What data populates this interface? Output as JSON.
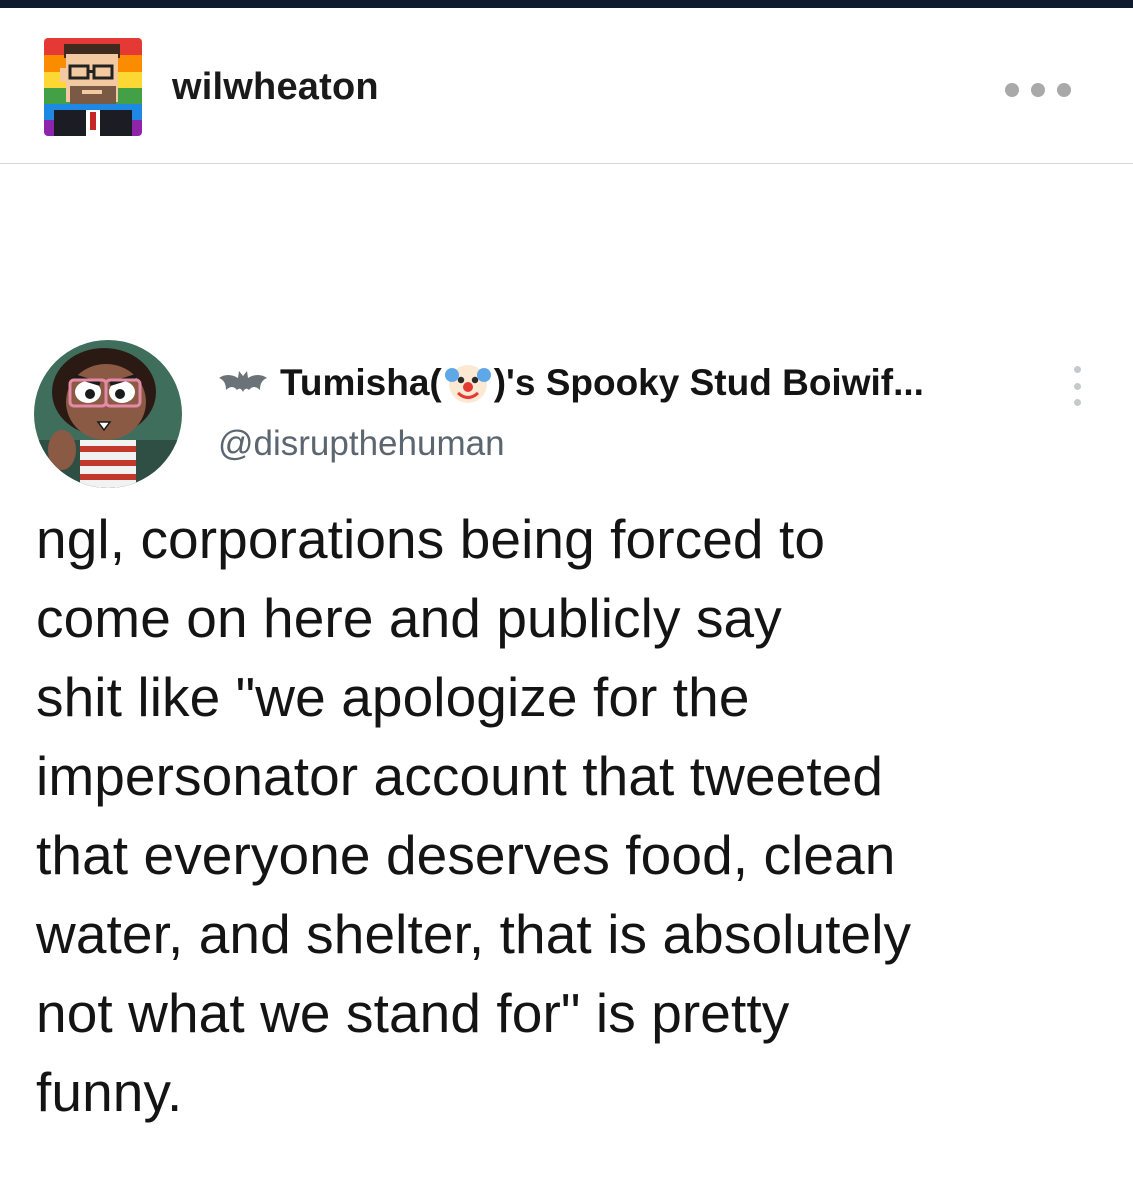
{
  "post": {
    "username": "wilwheaton",
    "more_icon": "more-horizontal-icon"
  },
  "tweet": {
    "display_name_prefix": "Tumisha(",
    "display_name_suffix": ")'s Spooky Stud Boiwif...",
    "name_icons": [
      "bat-icon",
      "clown-face-icon"
    ],
    "handle": "@disrupthehuman",
    "more_icon": "more-vertical-icon",
    "text_lines": [
      "ngl, corporations being forced to",
      "come on here and publicly say",
      "shit like \"we apologize for the",
      "impersonator account that tweeted",
      "that everyone deserves food, clean",
      "water, and shelter, that is absolutely",
      "not what we stand for\" is pretty",
      "funny."
    ]
  },
  "colors": {
    "top_border": "#0f1b2d",
    "divider": "#d6d6d6",
    "handle": "#5b6670",
    "dots": "#a9a9a9"
  }
}
